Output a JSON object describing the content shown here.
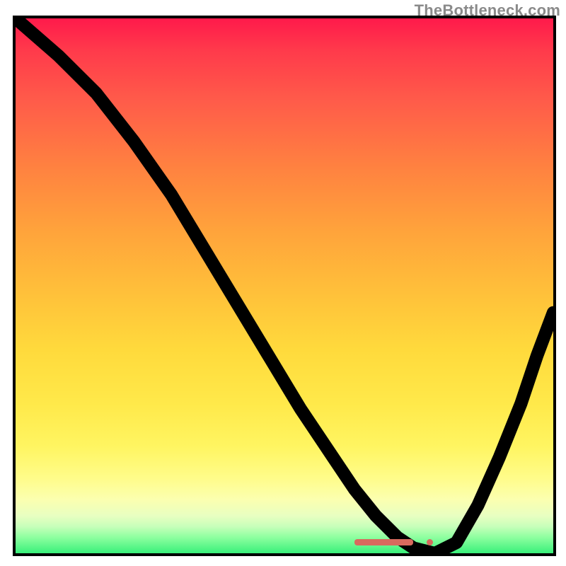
{
  "watermark": "TheBottleneck.com",
  "chart_data": {
    "type": "line",
    "title": "",
    "xlabel": "",
    "ylabel": "",
    "xlim": [
      0,
      100
    ],
    "ylim": [
      0,
      100
    ],
    "grid": false,
    "legend": false,
    "series": [
      {
        "name": "curve",
        "x": [
          0,
          8,
          15,
          22,
          29,
          35,
          41,
          47,
          53,
          59,
          63,
          67,
          71,
          74,
          78,
          82,
          86,
          90,
          94,
          97,
          100
        ],
        "y": [
          100,
          93,
          86,
          77,
          67,
          57,
          47,
          37,
          27,
          18,
          12,
          7,
          3,
          1,
          0,
          2,
          9,
          18,
          28,
          37,
          45
        ]
      }
    ],
    "marker": {
      "x_start": 63,
      "x_end": 74,
      "y": 1.5,
      "dot_x": 77,
      "dot_y": 1.5
    },
    "background_gradient_stops": [
      {
        "pos": 0,
        "color": "#ff1a4b"
      },
      {
        "pos": 50,
        "color": "#ffc23a"
      },
      {
        "pos": 85,
        "color": "#fffc8a"
      },
      {
        "pos": 100,
        "color": "#39f07a"
      }
    ]
  }
}
